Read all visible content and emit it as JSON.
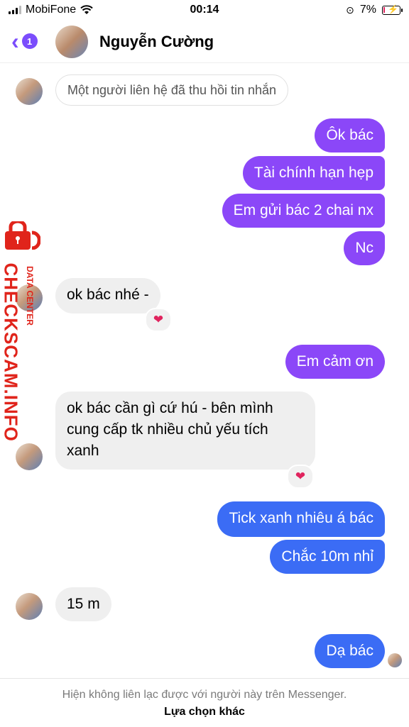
{
  "status_bar": {
    "carrier": "MobiFone",
    "time": "00:14",
    "battery": "7%"
  },
  "header": {
    "back_count": "1",
    "contact_name": "Nguyễn Cường"
  },
  "notice": "Một người liên hệ đã thu hồi tin nhắn",
  "messages": [
    {
      "from": "me",
      "text": "Ôk bác"
    },
    {
      "from": "me",
      "text": "Tài chính hạn hẹp"
    },
    {
      "from": "me",
      "text": "Em gửi bác 2 chai nx"
    },
    {
      "from": "me",
      "text": "Nc"
    },
    {
      "from": "them",
      "text": "ok bác nhé -",
      "reaction": "❤"
    },
    {
      "from": "me",
      "text": "Em cảm ơn"
    },
    {
      "from": "them",
      "text": "ok bác cần gì cứ hú - bên mình cung cấp tk nhiều chủ yếu tích xanh",
      "lines": [
        "ok bác cần gì cứ hú - bên mình",
        "cung cấp tk nhiều chủ yếu tích",
        "xanh"
      ],
      "reaction": "❤"
    },
    {
      "from": "me",
      "text": "Tick xanh nhiêu á bác"
    },
    {
      "from": "me",
      "text": "Chắc 10m nhỉ"
    },
    {
      "from": "them",
      "text": "15 m"
    },
    {
      "from": "me",
      "text": "Dạ bác"
    }
  ],
  "watermark": {
    "main": "CHECKSCAM.INFO",
    "sub": "DATA CENTER"
  },
  "footer": {
    "message": "Hiện không liên lạc được với người này trên Messenger.",
    "option": "Lựa chọn khác"
  },
  "colors": {
    "purple_bubble": "#8b47f8",
    "blue_bubble": "#3b6cf5",
    "accent": "#7b4dfc",
    "watermark": "#e0241b"
  }
}
